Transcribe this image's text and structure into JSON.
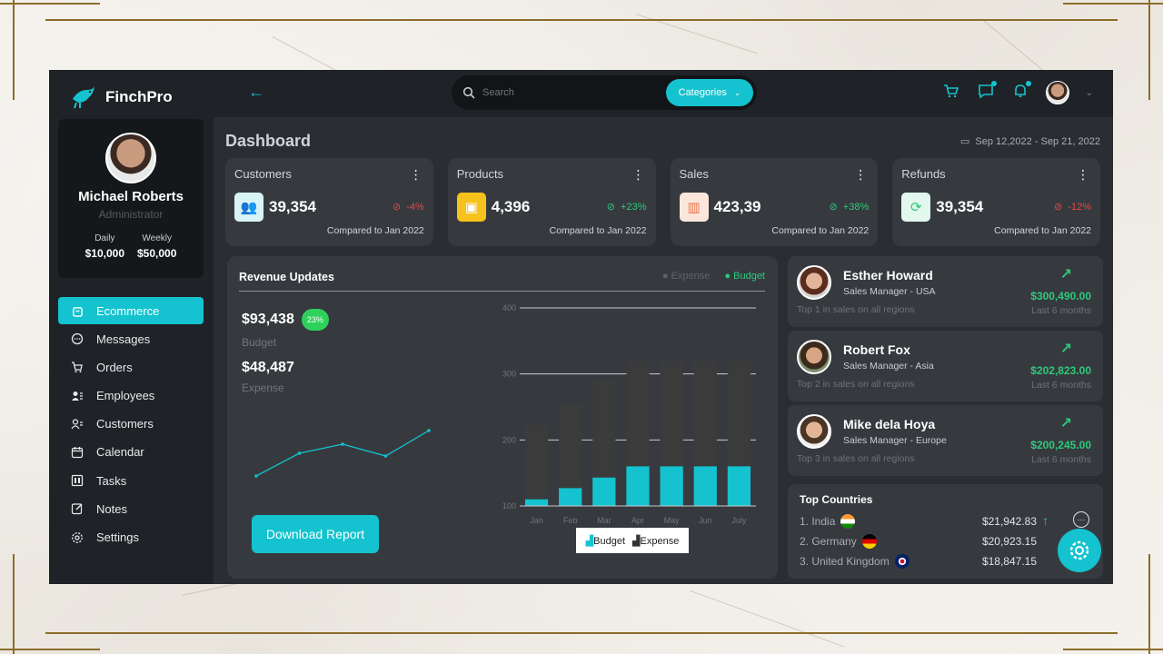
{
  "brand": {
    "name": "FinchPro"
  },
  "profile": {
    "name": "Michael Roberts",
    "role": "Administrator",
    "stats": [
      {
        "label": "Daily",
        "value": "$10,000"
      },
      {
        "label": "Weekly",
        "value": "$50,000"
      }
    ]
  },
  "nav": [
    {
      "label": "Ecommerce",
      "icon": "bag-icon",
      "active": true
    },
    {
      "label": "Messages",
      "icon": "chat-icon"
    },
    {
      "label": "Orders",
      "icon": "cart-icon"
    },
    {
      "label": "Employees",
      "icon": "employees-icon"
    },
    {
      "label": "Customers",
      "icon": "customers-icon"
    },
    {
      "label": "Calendar",
      "icon": "calendar-icon"
    },
    {
      "label": "Tasks",
      "icon": "tasks-icon"
    },
    {
      "label": "Notes",
      "icon": "notes-icon"
    },
    {
      "label": "Settings",
      "icon": "gear-icon"
    }
  ],
  "search": {
    "placeholder": "Search",
    "category_label": "Categories"
  },
  "dashboard": {
    "title": "Dashboard",
    "date_range": "Sep 12,2022 - Sep 21, 2022"
  },
  "kpis": [
    {
      "title": "Customers",
      "value": "39,354",
      "change": "-4%",
      "trend": "down",
      "compare": "Compared to Jan 2022",
      "icon_bg": "#d9f4f6",
      "icon_color": "#14c3cf"
    },
    {
      "title": "Products",
      "value": "4,396",
      "change": "+23%",
      "trend": "up",
      "compare": "Compared to Jan 2022",
      "icon_bg": "#f7c21b",
      "icon_color": "#ffffff"
    },
    {
      "title": "Sales",
      "value": "423,39",
      "change": "+38%",
      "trend": "up",
      "compare": "Compared to Jan 2022",
      "icon_bg": "#fbe6dc",
      "icon_color": "#e8744a"
    },
    {
      "title": "Refunds",
      "value": "39,354",
      "change": "-12%",
      "trend": "down",
      "compare": "Compared to Jan 2022",
      "icon_bg": "#e2f7ee",
      "icon_color": "#2ec97a"
    }
  ],
  "revenue": {
    "title": "Revenue Updates",
    "legend": [
      "Expense",
      "Budget"
    ],
    "budget_value": "$93,438",
    "budget_badge": "23%",
    "budget_label": "Budget",
    "expense_value": "$48,487",
    "expense_label": "Expense",
    "download_label": "Download Report",
    "chart_legend": [
      "Budget",
      "Expense"
    ]
  },
  "chart_data": [
    {
      "type": "line",
      "x": [
        1,
        2,
        3,
        4,
        5
      ],
      "values": [
        20,
        45,
        55,
        42,
        70
      ],
      "title": "",
      "xlabel": "",
      "ylabel": ""
    },
    {
      "type": "bar",
      "categories": [
        "Jan",
        "Feb",
        "Mar",
        "Apr",
        "May",
        "Jun",
        "July"
      ],
      "series": [
        {
          "name": "Budget",
          "values": [
            110,
            127,
            143,
            160,
            160,
            160,
            160
          ]
        },
        {
          "name": "Expense",
          "values": [
            222,
            253,
            289,
            319,
            319,
            319,
            319
          ]
        }
      ],
      "yticks": [
        100,
        200,
        300,
        400
      ],
      "ylim": [
        100,
        400
      ],
      "title": "",
      "xlabel": "",
      "ylabel": "",
      "colors": {
        "Budget": "#14c3cf",
        "Expense": "#3b3b3b"
      },
      "grid": true
    }
  ],
  "people": [
    {
      "name": "Esther Howard",
      "title": "Sales Manager - USA",
      "rank": "Top 1 in sales on all regions",
      "amount": "$300,490.00",
      "period": "Last 6 months"
    },
    {
      "name": "Robert Fox",
      "title": "Sales Manager - Asia",
      "rank": "Top 2 in sales on all regions",
      "amount": "$202,823.00",
      "period": "Last 6 months"
    },
    {
      "name": "Mike dela Hoya",
      "title": "Sales Manager - Europe",
      "rank": "Top 3 in sales on all regions",
      "amount": "$200,245.00",
      "period": "Last 6 months"
    }
  ],
  "countries": {
    "title": "Top Countries",
    "rows": [
      {
        "name": "1. India",
        "amount": "$21,942.83",
        "flag": "india"
      },
      {
        "name": "2. Germany",
        "amount": "$20,923.15",
        "flag": "germany"
      },
      {
        "name": "3. United Kingdom",
        "amount": "$18,847.15",
        "flag": "uk"
      }
    ]
  }
}
